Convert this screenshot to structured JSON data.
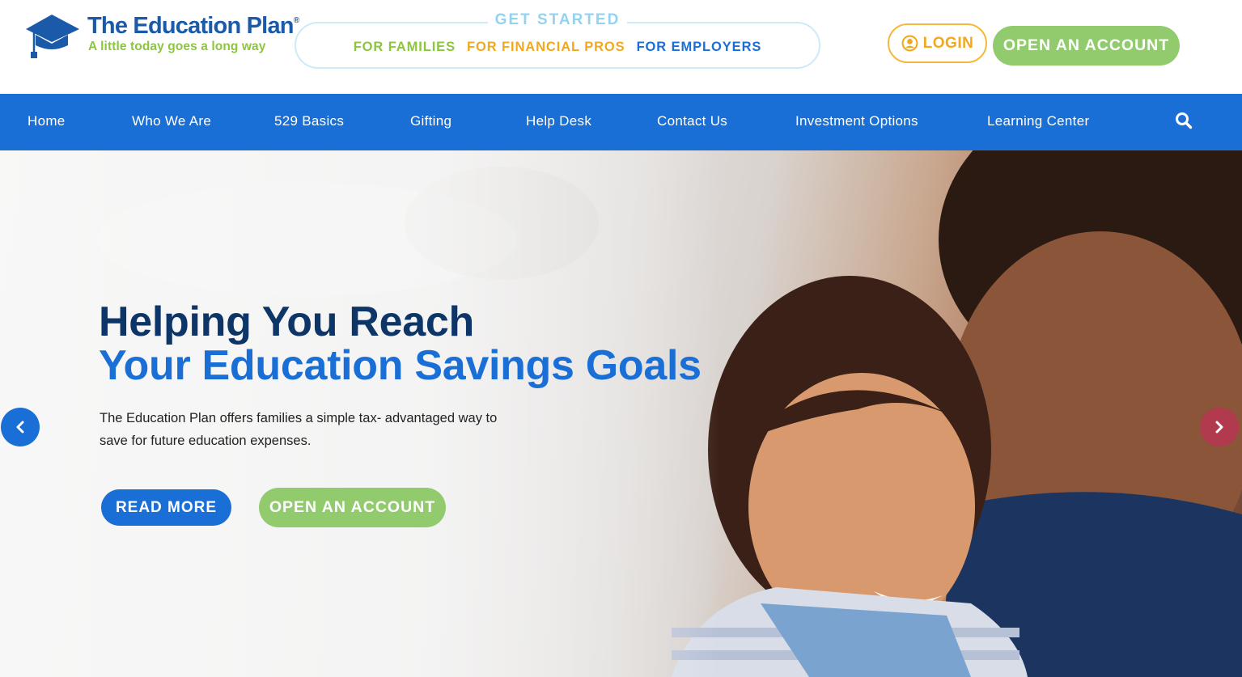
{
  "brand": {
    "name": "The Education Plan",
    "registered_mark": "®",
    "tagline": "A little today goes a long way",
    "primary_color": "#1a6fd6",
    "navy_color": "#0e3568",
    "green_color": "#91cb6d",
    "orange_color": "#f2a81e"
  },
  "header": {
    "get_started": {
      "title": "GET STARTED",
      "links": [
        {
          "label": "FOR FAMILIES",
          "color": "#8cc53f"
        },
        {
          "label": "FOR FINANCIAL PROS",
          "color": "#f2a81e"
        },
        {
          "label": "FOR EMPLOYERS",
          "color": "#1a6fd6"
        }
      ]
    },
    "login_label": "LOGIN",
    "login_icon": "user-circle-icon",
    "open_account_label": "OPEN AN ACCOUNT"
  },
  "nav": {
    "items": [
      {
        "label": "Home"
      },
      {
        "label": "Who We Are"
      },
      {
        "label": "529 Basics"
      },
      {
        "label": "Gifting"
      },
      {
        "label": "Help Desk"
      },
      {
        "label": "Contact Us"
      },
      {
        "label": "Investment Options"
      },
      {
        "label": "Learning Center"
      }
    ],
    "search_icon": "search-icon"
  },
  "hero": {
    "heading_line1": "Helping You Reach",
    "heading_line2": "Your Education Savings Goals",
    "description": "The Education Plan offers families a simple tax- advantaged way to save for future education expenses.",
    "read_more_label": "READ MORE",
    "open_account_label": "OPEN AN ACCOUNT",
    "prev_icon": "chevron-left-icon",
    "next_icon": "chevron-right-icon"
  }
}
